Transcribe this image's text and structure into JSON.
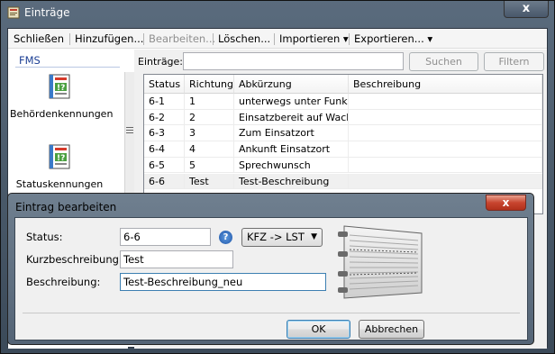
{
  "window": {
    "title": "Einträge",
    "close_label": "x"
  },
  "menu": {
    "close": "Schließen",
    "add": "Hinzufügen...",
    "edit": "Bearbeiten...",
    "delete": "Löschen...",
    "import": "Importieren ▾",
    "export": "Exportieren... ▾"
  },
  "sidebar": {
    "header": "FMS",
    "items": [
      {
        "label": "Behördenkennungen",
        "icon": "form-icon"
      },
      {
        "label": "Statuskennungen",
        "icon": "form-icon"
      }
    ]
  },
  "filter": {
    "label": "Einträge:",
    "value": "",
    "search_button": "Suchen",
    "filter_button": "Filtern"
  },
  "table": {
    "columns": [
      "Status",
      "Richtung",
      "Abkürzung",
      "Beschreibung"
    ],
    "rows": [
      [
        "6-1",
        "1",
        "unterwegs unter Funk",
        ""
      ],
      [
        "6-2",
        "2",
        "Einsatzbereit auf Wache",
        ""
      ],
      [
        "6-3",
        "3",
        "Zum Einsatzort",
        ""
      ],
      [
        "6-4",
        "4",
        "Ankunft Einsatzort",
        ""
      ],
      [
        "6-5",
        "5",
        "Sprechwunsch",
        ""
      ],
      [
        "6-6",
        "Test",
        "Test-Beschreibung",
        ""
      ]
    ],
    "selected_row": 5
  },
  "dialog": {
    "title": "Eintrag bearbeiten",
    "close_label": "x",
    "status_label": "Status:",
    "status_value": "6-6",
    "short_label": "Kurzbeschreibung:",
    "short_value": "Test",
    "desc_label": "Beschreibung:",
    "desc_value": "Test-Beschreibung_neu",
    "help_label": "?",
    "direction_value": "KFZ -> LST",
    "direction_caret": "▼",
    "ok_label": "OK",
    "cancel_label": "Abbrechen"
  },
  "colors": {
    "accent": "#1c3f94",
    "dialog_close": "#c8452f",
    "focus_border": "#3c7fb1"
  }
}
